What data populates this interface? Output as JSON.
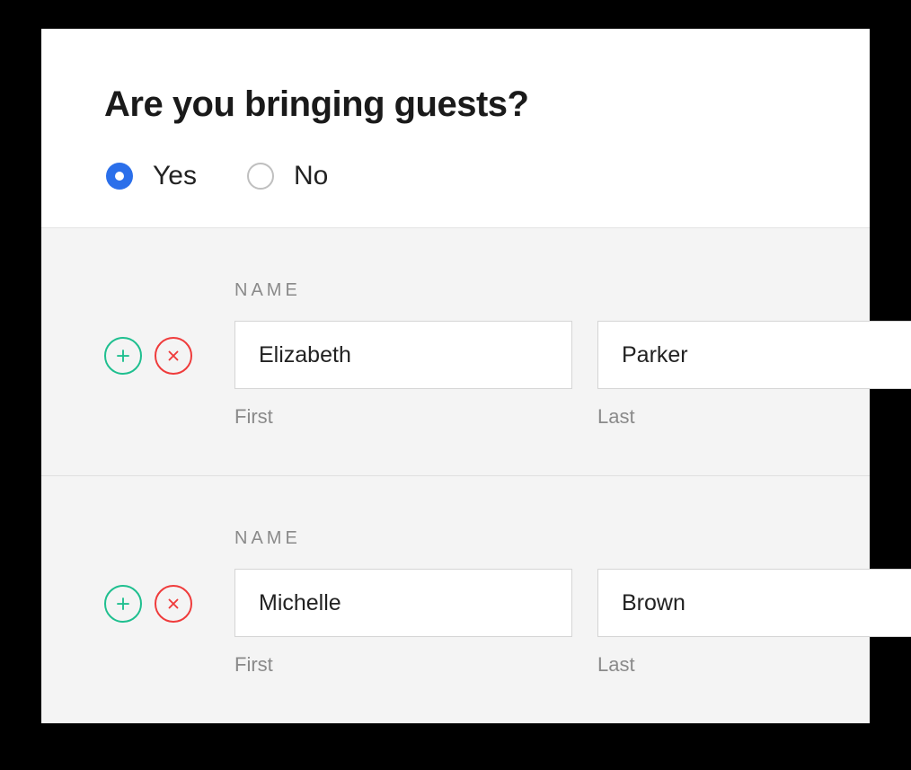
{
  "question": "Are you bringing guests?",
  "options": {
    "yes": "Yes",
    "no": "No",
    "selected": "yes"
  },
  "section_label": "NAME",
  "sub_labels": {
    "first": "First",
    "last": "Last"
  },
  "guests": [
    {
      "first": "Elizabeth",
      "last": "Parker"
    },
    {
      "first": "Michelle",
      "last": "Brown"
    }
  ]
}
